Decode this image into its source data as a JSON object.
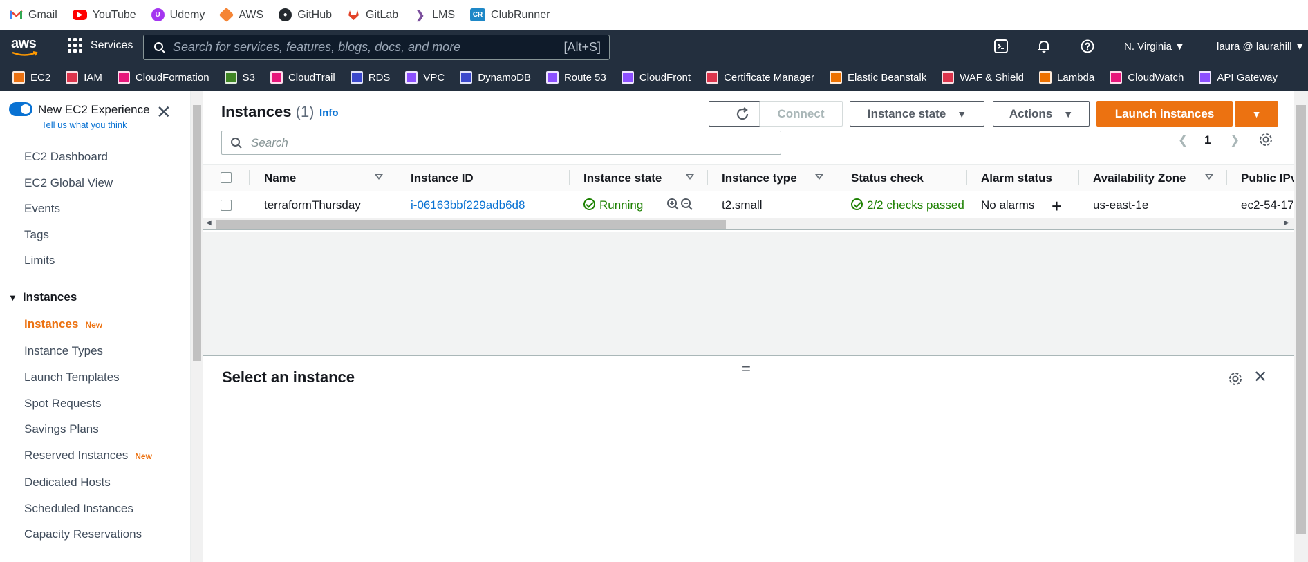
{
  "bookmarks": [
    {
      "label": "Gmail",
      "icon": "gmail-icon",
      "color": "#ea4335"
    },
    {
      "label": "YouTube",
      "icon": "youtube-icon",
      "color": "#ff0000"
    },
    {
      "label": "Udemy",
      "icon": "udemy-icon",
      "color": "#a435f0"
    },
    {
      "label": "AWS",
      "icon": "aws-cube-icon",
      "color": "#f58536"
    },
    {
      "label": "GitHub",
      "icon": "github-icon",
      "color": "#24292e"
    },
    {
      "label": "GitLab",
      "icon": "gitlab-icon",
      "color": "#e24329"
    },
    {
      "label": "LMS",
      "icon": "lms-icon",
      "color": "#7b4f9d"
    },
    {
      "label": "ClubRunner",
      "icon": "clubrunner-icon",
      "color": "#1e88c7"
    }
  ],
  "header": {
    "logo": "aws",
    "services_label": "Services",
    "search_placeholder": "Search for services, features, blogs, docs, and more",
    "search_shortcut": "[Alt+S]",
    "region": "N. Virginia",
    "user": "laura @ laurahill"
  },
  "service_shortcuts": [
    {
      "label": "EC2",
      "color": "#ec7211"
    },
    {
      "label": "IAM",
      "color": "#dd344c"
    },
    {
      "label": "CloudFormation",
      "color": "#e7157b"
    },
    {
      "label": "S3",
      "color": "#3f8624"
    },
    {
      "label": "CloudTrail",
      "color": "#e7157b"
    },
    {
      "label": "RDS",
      "color": "#3b48cc"
    },
    {
      "label": "VPC",
      "color": "#8c4fff"
    },
    {
      "label": "DynamoDB",
      "color": "#3b48cc"
    },
    {
      "label": "Route 53",
      "color": "#8c4fff"
    },
    {
      "label": "CloudFront",
      "color": "#8c4fff"
    },
    {
      "label": "Certificate Manager",
      "color": "#dd344c"
    },
    {
      "label": "Elastic Beanstalk",
      "color": "#ed7100"
    },
    {
      "label": "WAF & Shield",
      "color": "#dd344c"
    },
    {
      "label": "Lambda",
      "color": "#ed7100"
    },
    {
      "label": "CloudWatch",
      "color": "#e7157b"
    },
    {
      "label": "API Gateway",
      "color": "#8c4fff"
    }
  ],
  "sidebar": {
    "experience_label": "New EC2 Experience",
    "feedback_link": "Tell us what you think",
    "items": [
      {
        "label": "EC2 Dashboard"
      },
      {
        "label": "EC2 Global View"
      },
      {
        "label": "Events"
      },
      {
        "label": "Tags"
      },
      {
        "label": "Limits"
      }
    ],
    "section_label": "Instances",
    "section_items": [
      {
        "label": "Instances",
        "badge": "New",
        "active": true
      },
      {
        "label": "Instance Types"
      },
      {
        "label": "Launch Templates"
      },
      {
        "label": "Spot Requests"
      },
      {
        "label": "Savings Plans"
      },
      {
        "label": "Reserved Instances",
        "badge": "New"
      },
      {
        "label": "Dedicated Hosts"
      },
      {
        "label": "Scheduled Instances"
      },
      {
        "label": "Capacity Reservations"
      }
    ]
  },
  "main": {
    "title": "Instances",
    "count": "(1)",
    "info_label": "Info",
    "connect_label": "Connect",
    "instance_state_label": "Instance state",
    "actions_label": "Actions",
    "launch_label": "Launch instances",
    "search_placeholder": "Search",
    "page_number": "1",
    "columns": [
      "Name",
      "Instance ID",
      "Instance state",
      "Instance type",
      "Status check",
      "Alarm status",
      "Availability Zone",
      "Public IPv"
    ],
    "rows": [
      {
        "name": "terraformThursday",
        "instance_id": "i-06163bbf229adb6d8",
        "state": "Running",
        "type": "t2.small",
        "status_check": "2/2 checks passed",
        "alarm_status": "No alarms",
        "zone": "us-east-1e",
        "public_ip": "ec2-54-17"
      }
    ],
    "split_title": "Select an instance"
  }
}
